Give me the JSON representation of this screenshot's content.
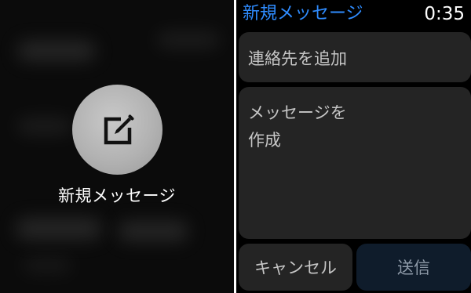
{
  "left_pane": {
    "menu_option": {
      "icon": "compose-icon",
      "label": "新規メッセージ"
    }
  },
  "right_pane": {
    "title": "新規メッセージ",
    "time": "0:35",
    "contact_field": {
      "placeholder": "連絡先を追加"
    },
    "message_field": {
      "placeholder": "メッセージを\n作成"
    },
    "buttons": {
      "cancel_label": "キャンセル",
      "send_label": "送信"
    }
  },
  "colors": {
    "accent": "#2f8cff",
    "background": "#000000",
    "field": "#242424",
    "send_button": "#0f1c2b"
  }
}
